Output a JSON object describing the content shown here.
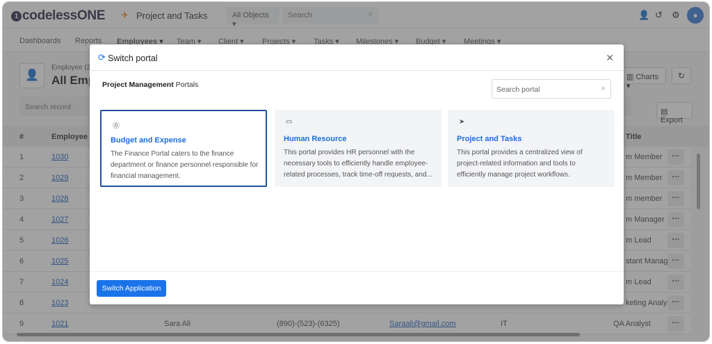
{
  "topbar": {
    "logo_text": "codelessONE",
    "app_title": "Project and Tasks",
    "objects_select": "All Objects",
    "search_placeholder": "Search"
  },
  "nav": {
    "items": [
      "Dashboards",
      "Reports",
      "Employees",
      "Team",
      "Client",
      "Projects",
      "Tasks",
      "Milestones",
      "Budget",
      "Meetings"
    ],
    "active": "Employees"
  },
  "page": {
    "entity_sub": "Employee (2",
    "title": "All Emp",
    "charts_label": "Charts",
    "search_record_placeholder": "Search record",
    "export_label": "Export",
    "columns": {
      "index": "#",
      "employee_id": "Employee ID",
      "title": "Title"
    },
    "rows": [
      {
        "n": "1",
        "id": "1030",
        "title": "m Member"
      },
      {
        "n": "2",
        "id": "1029",
        "title": "m Member"
      },
      {
        "n": "3",
        "id": "1028",
        "title": "m member"
      },
      {
        "n": "4",
        "id": "1027",
        "title": "m Manager"
      },
      {
        "n": "5",
        "id": "1026",
        "title": "m Lead"
      },
      {
        "n": "6",
        "id": "1025",
        "title": "stant Manage"
      },
      {
        "n": "7",
        "id": "1024",
        "title": "m Lead"
      },
      {
        "n": "8",
        "id": "1023",
        "title": "keting Analys"
      },
      {
        "n": "9",
        "id": "1021",
        "name": "Sara Ali",
        "phone": "(890)-(523)-(6325)",
        "email": "Saraali@gmail.com",
        "dept": "IT",
        "title": "QA Analyst"
      }
    ]
  },
  "modal": {
    "title": "Switch portal",
    "heading_bold": "Project Management",
    "heading_rest": " Portals",
    "search_placeholder": "Search portal",
    "cards": [
      {
        "title": "Budget and Expense",
        "desc": "The Finance Portal caters to the finance department or finance personnel responsible for financial management.",
        "icon": "dollar-icon",
        "selected": true
      },
      {
        "title": "Human Resource",
        "desc": "This portal provides HR personnel with the necessary tools to efficiently handle employee-related processes, track time-off requests, and...",
        "icon": "id-card-icon",
        "selected": false
      },
      {
        "title": "Project and Tasks",
        "desc": "This portal provides a centralized view of project-related information and tools to efficiently manage project workflows.",
        "icon": "paper-plane-icon",
        "selected": false
      }
    ],
    "switch_button": "Switch Application"
  },
  "colors": {
    "accent": "#1a73e8",
    "selected_border": "#1f4f9a",
    "link": "#1f5fbf"
  }
}
